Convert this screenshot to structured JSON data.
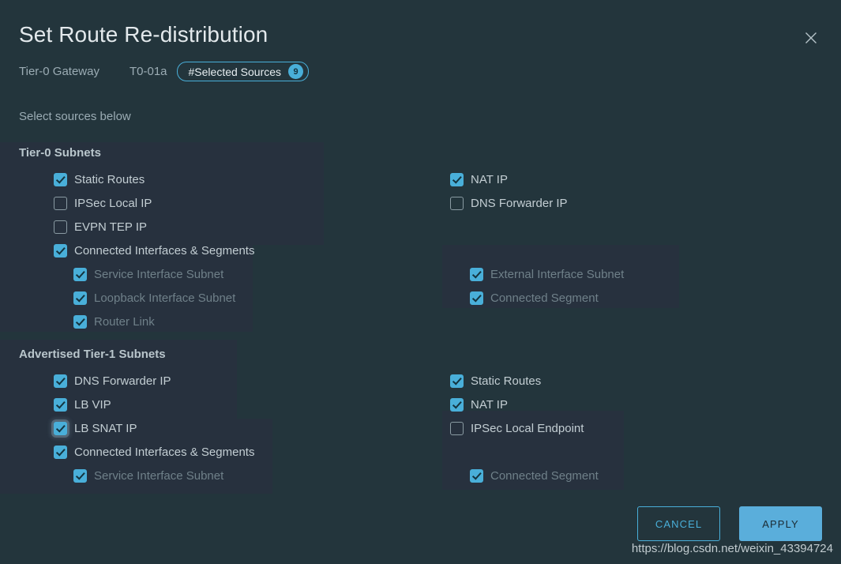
{
  "dialog": {
    "title": "Set Route Re-distribution",
    "close_icon": "close-icon",
    "instruction": "Select sources below",
    "subheader": {
      "label": "Tier-0 Gateway",
      "value": "T0-01a",
      "badge_text": "#Selected Sources",
      "badge_count": "9"
    },
    "footer": {
      "cancel_label": "CANCEL",
      "apply_label": "APPLY"
    }
  },
  "colors": {
    "background": "#23353c",
    "tint": "#27313e",
    "accent": "#49afd9",
    "apply_bg": "#5aaedb",
    "text": "#c3ced3",
    "text_dim": "#6f8089",
    "title": "#e3e9ec"
  },
  "groups": [
    {
      "title": "Tier-0 Subnets",
      "left": [
        {
          "label": "Static Routes",
          "checked": true,
          "indent": false,
          "dim": false,
          "focused": false
        },
        {
          "label": "IPSec Local IP",
          "checked": false,
          "indent": false,
          "dim": false,
          "focused": false
        },
        {
          "label": "EVPN TEP IP",
          "checked": false,
          "indent": false,
          "dim": false,
          "focused": false
        },
        {
          "label": "Connected Interfaces & Segments",
          "checked": true,
          "indent": false,
          "dim": false,
          "focused": false
        },
        {
          "label": "Service Interface Subnet",
          "checked": true,
          "indent": true,
          "dim": true,
          "focused": false
        },
        {
          "label": "Loopback Interface Subnet",
          "checked": true,
          "indent": true,
          "dim": true,
          "focused": false
        },
        {
          "label": "Router Link",
          "checked": true,
          "indent": true,
          "dim": true,
          "focused": false
        }
      ],
      "right": [
        {
          "label": "NAT IP",
          "checked": true,
          "indent": false,
          "dim": false,
          "focused": false
        },
        {
          "label": "DNS Forwarder IP",
          "checked": false,
          "indent": false,
          "dim": false,
          "focused": false
        },
        {
          "label": "",
          "spacer": true
        },
        {
          "label": "",
          "spacer": true
        },
        {
          "label": "External Interface Subnet",
          "checked": true,
          "indent": true,
          "dim": true,
          "focused": false
        },
        {
          "label": "Connected Segment",
          "checked": true,
          "indent": true,
          "dim": true,
          "focused": false
        }
      ]
    },
    {
      "title": "Advertised Tier-1 Subnets",
      "left": [
        {
          "label": "DNS Forwarder IP",
          "checked": true,
          "indent": false,
          "dim": false,
          "focused": false
        },
        {
          "label": "LB VIP",
          "checked": true,
          "indent": false,
          "dim": false,
          "focused": false
        },
        {
          "label": "LB SNAT IP",
          "checked": true,
          "indent": false,
          "dim": false,
          "focused": true
        },
        {
          "label": "Connected Interfaces & Segments",
          "checked": true,
          "indent": false,
          "dim": false,
          "focused": false
        },
        {
          "label": "Service Interface Subnet",
          "checked": true,
          "indent": true,
          "dim": true,
          "focused": false
        }
      ],
      "right": [
        {
          "label": "Static Routes",
          "checked": true,
          "indent": false,
          "dim": false,
          "focused": false
        },
        {
          "label": "NAT IP",
          "checked": true,
          "indent": false,
          "dim": false,
          "focused": false
        },
        {
          "label": "IPSec Local Endpoint",
          "checked": false,
          "indent": false,
          "dim": false,
          "focused": false
        },
        {
          "label": "",
          "spacer": true
        },
        {
          "label": "Connected Segment",
          "checked": true,
          "indent": true,
          "dim": true,
          "focused": false
        }
      ]
    }
  ],
  "watermark": "https://blog.csdn.net/weixin_43394724"
}
